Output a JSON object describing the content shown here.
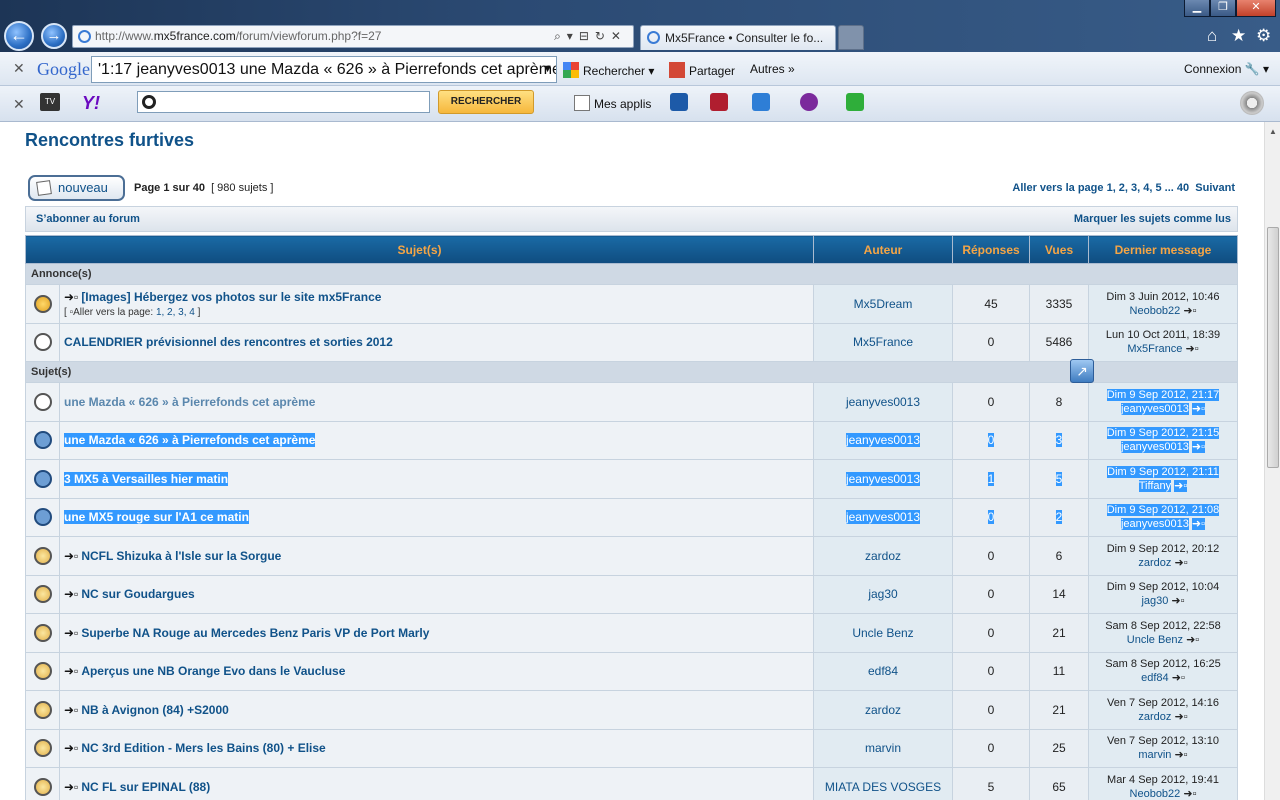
{
  "browser": {
    "url_prefix": "http://www.",
    "url_domain": "mx5france.com",
    "url_path": "/forum/viewforum.php?f=27",
    "tab_title": "Mx5France • Consulter le fo...",
    "google_search_value": "'1:17 jeanyves0013 une Mazda « 626 » à Pierrefonds cet aprème",
    "google_logo": "Google",
    "rechercher_label": "Rechercher",
    "partager_label": "Partager",
    "autres_label": "Autres",
    "connexion_label": "Connexion",
    "yahoo_logo": "Y!",
    "tv_label": "TV",
    "yahoo_button": "RECHERCHER",
    "mes_applis": "Mes applis"
  },
  "forum": {
    "title": "Rencontres furtives",
    "new_button": "nouveau",
    "page_info": "Page 1 sur 40",
    "topic_count": "[ 980 sujets ]",
    "goto_label": "Aller vers la page",
    "goto_pages": "1, 2, 3, 4, 5 ... 40",
    "next_label": "Suivant",
    "subscribe": "S’abonner au forum",
    "mark_read": "Marquer les sujets comme lus"
  },
  "table": {
    "headers": {
      "subject": "Sujet(s)",
      "author": "Auteur",
      "replies": "Réponses",
      "views": "Vues",
      "last": "Dernier message"
    },
    "announce_label": "Annonce(s)",
    "topics_label": "Sujet(s)",
    "announcements": [
      {
        "title": "[Images] Hébergez vos photos sur le site mx5France",
        "pages_label": "[ ",
        "pages_prefix": "Aller vers la page:",
        "pages": "1, 2, 3, 4",
        "pages_suffix": " ]",
        "author": "Mx5Dream",
        "replies": "45",
        "views": "3335",
        "last_date": "Dim 3 Juin 2012, 10:46",
        "last_by": "Neobob22"
      },
      {
        "title": "CALENDRIER prévisionnel des rencontres et sorties 2012",
        "author": "Mx5France",
        "replies": "0",
        "views": "5486",
        "last_date": "Lun 10 Oct 2011, 18:39",
        "last_by": "Mx5France"
      }
    ],
    "topics": [
      {
        "title": "une Mazda « 626 » à Pierrefonds cet aprème",
        "author": "jeanyves0013",
        "replies": "0",
        "views": "8",
        "last_date": "Dim 9 Sep 2012, 21:17",
        "last_by": "jeanyves0013"
      },
      {
        "title": "une Mazda « 626 » à Pierrefonds cet aprème",
        "author": "jeanyves0013",
        "replies": "0",
        "views": "3",
        "last_date": "Dim 9 Sep 2012, 21:15",
        "last_by": "jeanyves0013"
      },
      {
        "title": "3 MX5 à Versailles hier matin",
        "author": "jeanyves0013",
        "replies": "1",
        "views": "5",
        "last_date": "Dim 9 Sep 2012, 21:11",
        "last_by": "Tiffany"
      },
      {
        "title": "une MX5 rouge sur l'A1 ce matin",
        "author": "jeanyves0013",
        "replies": "0",
        "views": "2",
        "last_date": "Dim 9 Sep 2012, 21:08",
        "last_by": "jeanyves0013"
      },
      {
        "title": "NCFL Shizuka à l'Isle sur la Sorgue",
        "author": "zardoz",
        "replies": "0",
        "views": "6",
        "last_date": "Dim 9 Sep 2012, 20:12",
        "last_by": "zardoz"
      },
      {
        "title": "NC sur Goudargues",
        "author": "jag30",
        "replies": "0",
        "views": "14",
        "last_date": "Dim 9 Sep 2012, 10:04",
        "last_by": "jag30"
      },
      {
        "title": "Superbe NA Rouge au Mercedes Benz Paris VP de Port Marly",
        "author": "Uncle Benz",
        "replies": "0",
        "views": "21",
        "last_date": "Sam 8 Sep 2012, 22:58",
        "last_by": "Uncle Benz"
      },
      {
        "title": "Aperçus une NB Orange Evo dans le Vaucluse",
        "author": "edf84",
        "replies": "0",
        "views": "11",
        "last_date": "Sam 8 Sep 2012, 16:25",
        "last_by": "edf84"
      },
      {
        "title": "NB à Avignon (84) +S2000",
        "author": "zardoz",
        "replies": "0",
        "views": "21",
        "last_date": "Ven 7 Sep 2012, 14:16",
        "last_by": "zardoz"
      },
      {
        "title": "NC 3rd Edition - Mers les Bains (80) + Elise",
        "author": "marvin",
        "replies": "0",
        "views": "25",
        "last_date": "Ven 7 Sep 2012, 13:10",
        "last_by": "marvin"
      },
      {
        "title": "NC FL sur EPINAL (88)",
        "author": "MIATA DES VOSGES",
        "replies": "5",
        "views": "65",
        "last_date": "Mar 4 Sep 2012, 19:41",
        "last_by": "Neobob22"
      }
    ]
  }
}
